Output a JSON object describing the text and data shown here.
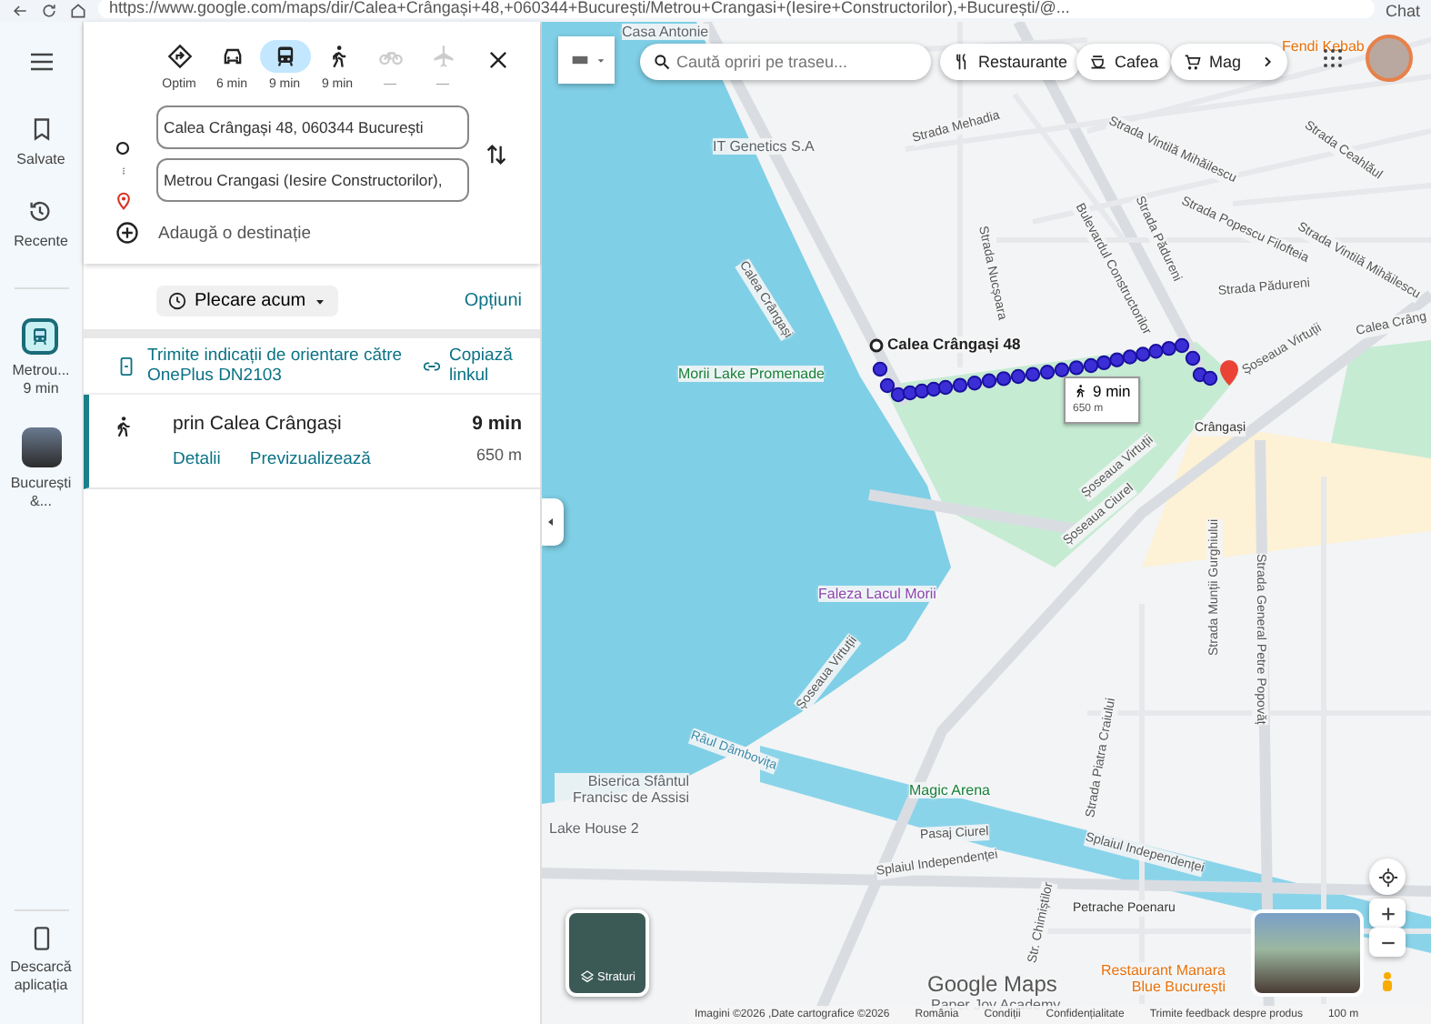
{
  "browser": {
    "url": "https://www.google.com/maps/dir/Calea+Crângași+48,+060344+București/Metrou+Crangasi+(Iesire+Constructorilor),+București/@...",
    "chat": "Chat"
  },
  "rail": {
    "items": [
      {
        "kind": "saved",
        "label": "Salvate"
      },
      {
        "kind": "recent",
        "label": "Recente"
      },
      {
        "kind": "transit",
        "label": "Metrou...",
        "sub": "9 min"
      },
      {
        "kind": "photo",
        "label": "București &..."
      }
    ],
    "download": "Descarcă aplicația"
  },
  "directions": {
    "modes": [
      {
        "kind": "best",
        "label": "Optim",
        "selected": false,
        "disabled": false
      },
      {
        "kind": "car",
        "label": "6 min",
        "selected": false,
        "disabled": false
      },
      {
        "kind": "transit",
        "label": "9 min",
        "selected": true,
        "disabled": false
      },
      {
        "kind": "walk",
        "label": "9 min",
        "selected": false,
        "disabled": false
      },
      {
        "kind": "bike",
        "label": "—",
        "selected": false,
        "disabled": true
      },
      {
        "kind": "flight",
        "label": "—",
        "selected": false,
        "disabled": true
      }
    ],
    "origin": "Calea Crângași 48, 060344 București",
    "destination": "Metrou Crangasi (Iesire Constructorilor),",
    "add_destination": "Adaugă o destinație",
    "departure": "Plecare acum",
    "options": "Opțiuni",
    "send": "Trimite indicații de orientare către OnePlus DN2103",
    "copy_link": "Copiază linkul",
    "routes": [
      {
        "via": "prin Calea Crângași",
        "time": "9 min",
        "distance": "650 m",
        "details": "Detalii",
        "preview": "Previzualizează",
        "selected": true
      }
    ]
  },
  "map": {
    "search_placeholder": "Caută opriri pe traseu...",
    "chips": [
      {
        "kind": "restaurant",
        "label": "Restaurante"
      },
      {
        "kind": "coffee",
        "label": "Cafea"
      },
      {
        "kind": "shop",
        "label": "Mag"
      }
    ],
    "origin_label": "Calea Crângași 48",
    "route_time": "9 min",
    "route_distance": "650 m",
    "labels": [
      {
        "text": "Casa Antonie",
        "kind": "poi"
      },
      {
        "text": "IT Genetics S.A",
        "kind": "poi"
      },
      {
        "text": "Strada Mehadia",
        "kind": "street"
      },
      {
        "text": "Strada Vintilă Mihăilescu",
        "kind": "street"
      },
      {
        "text": "Strada Ceahlăul",
        "kind": "street"
      },
      {
        "text": "Strada Popescu Filofteia",
        "kind": "street"
      },
      {
        "text": "Strada Vintilă Mihăilescu",
        "kind": "street"
      },
      {
        "text": "Calea Crângași",
        "kind": "street"
      },
      {
        "text": "Strada Nucșoara",
        "kind": "street"
      },
      {
        "text": "Bulevardul Constructorilor",
        "kind": "street"
      },
      {
        "text": "Strada Pădureni",
        "kind": "street"
      },
      {
        "text": "Strada Pădureni",
        "kind": "street"
      },
      {
        "text": "Calea Crâng",
        "kind": "street"
      },
      {
        "text": "Morii Lake Promenade",
        "kind": "park"
      },
      {
        "text": "Crângași",
        "kind": "transit"
      },
      {
        "text": "Șoseaua Virtuții",
        "kind": "street"
      },
      {
        "text": "Șoseaua Virtuții",
        "kind": "street"
      },
      {
        "text": "Șoseaua Ciurel",
        "kind": "street"
      },
      {
        "text": "Strada Munții Gurghiului",
        "kind": "street"
      },
      {
        "text": "Strada General Petre Popovăț",
        "kind": "street"
      },
      {
        "text": "Faleza Lacul Morii",
        "kind": "attraction"
      },
      {
        "text": "Râul Dâmbovița",
        "kind": "water"
      },
      {
        "text": "Șoseaua Virtuții",
        "kind": "street"
      },
      {
        "text": "Strada Piatra Craiului",
        "kind": "street"
      },
      {
        "text": "Biserica Sfântul Francisc de Assisi",
        "kind": "poi"
      },
      {
        "text": "Magic Arena",
        "kind": "park"
      },
      {
        "text": "Lake House 2",
        "kind": "poi"
      },
      {
        "text": "Pasaj Ciurel",
        "kind": "street"
      },
      {
        "text": "Splaiul Independenței",
        "kind": "street"
      },
      {
        "text": "Splaiul Independenței",
        "kind": "street"
      },
      {
        "text": "Petrache Poenaru",
        "kind": "transit"
      },
      {
        "text": "Str. Chimiștilor",
        "kind": "street"
      },
      {
        "text": "Restaurant Manara Blue București",
        "kind": "food"
      },
      {
        "text": "Fendi Kebab",
        "kind": "food"
      },
      {
        "text": "Paper Joy Academy",
        "kind": "poi"
      }
    ],
    "layers": "Straturi",
    "logo": "Google Maps",
    "footer": [
      "Imagini ©2026 ,Date cartografice ©2026",
      "România",
      "Condiții",
      "Confidențialitate",
      "Trimite feedback despre produs"
    ],
    "scale": "100 m"
  }
}
